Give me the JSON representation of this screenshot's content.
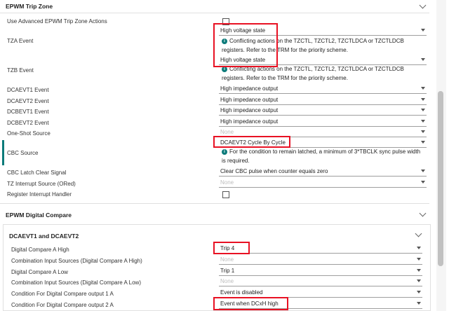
{
  "trip_zone": {
    "title": "EPWM Trip Zone",
    "rows": [
      {
        "label": "Use Advanced EPWM Trip Zone Actions"
      },
      {
        "label": "TZA Event",
        "value": "High voltage state",
        "info1": "Conflicting actions on the TZCTL, TZCTL2, TZCTLDCA or TZCTLDCB",
        "info2": "registers. Refer to the TRM for the priority scheme."
      },
      {
        "label": "TZB Event",
        "value": "High voltage state",
        "info1": "Conflicting actions on the TZCTL, TZCTL2, TZCTLDCA or TZCTLDCB",
        "info2": "registers. Refer to the TRM for the priority scheme."
      },
      {
        "label": "DCAEVT1 Event",
        "value": "High impedance output"
      },
      {
        "label": "DCAEVT2 Event",
        "value": "High impedance output"
      },
      {
        "label": "DCBEVT1 Event",
        "value": "High impedance output"
      },
      {
        "label": "DCBEVT2 Event",
        "value": "High impedance output"
      },
      {
        "label": "One-Shot Source",
        "value": "None"
      },
      {
        "label": "CBC Source",
        "value": "DCAEVT2 Cycle By Cycle",
        "info1": "For the condition to remain latched, a minimum of 3*TBCLK sync pulse width",
        "info2": "is required."
      },
      {
        "label": "CBC Latch Clear Signal",
        "value": "Clear CBC pulse when counter equals zero"
      },
      {
        "label": "TZ Interrupt Source (ORed)",
        "value": "None"
      },
      {
        "label": "Register Interrupt Handler"
      }
    ]
  },
  "digital_compare": {
    "title": "EPWM Digital Compare",
    "sub_title": "DCAEVT1 and DCAEVT2",
    "rows": [
      {
        "label": "Digital Compare A High",
        "value": "Trip 4"
      },
      {
        "label": "Combination Input Sources (Digital Compare A High)",
        "value": "None"
      },
      {
        "label": "Digital Compare A Low",
        "value": "Trip 1"
      },
      {
        "label": "Combination Input Sources (Digital Compare A Low)",
        "value": "None"
      },
      {
        "label": "Condition For Digital Compare output 1 A",
        "value": "Event is disabled"
      },
      {
        "label": "Condition For Digital Compare output 2 A",
        "value": "Event when DCxH high"
      }
    ]
  },
  "info_icon": "info-circle-icon",
  "accent_color": "#0c7b7a",
  "highlight_color": "#e81123"
}
